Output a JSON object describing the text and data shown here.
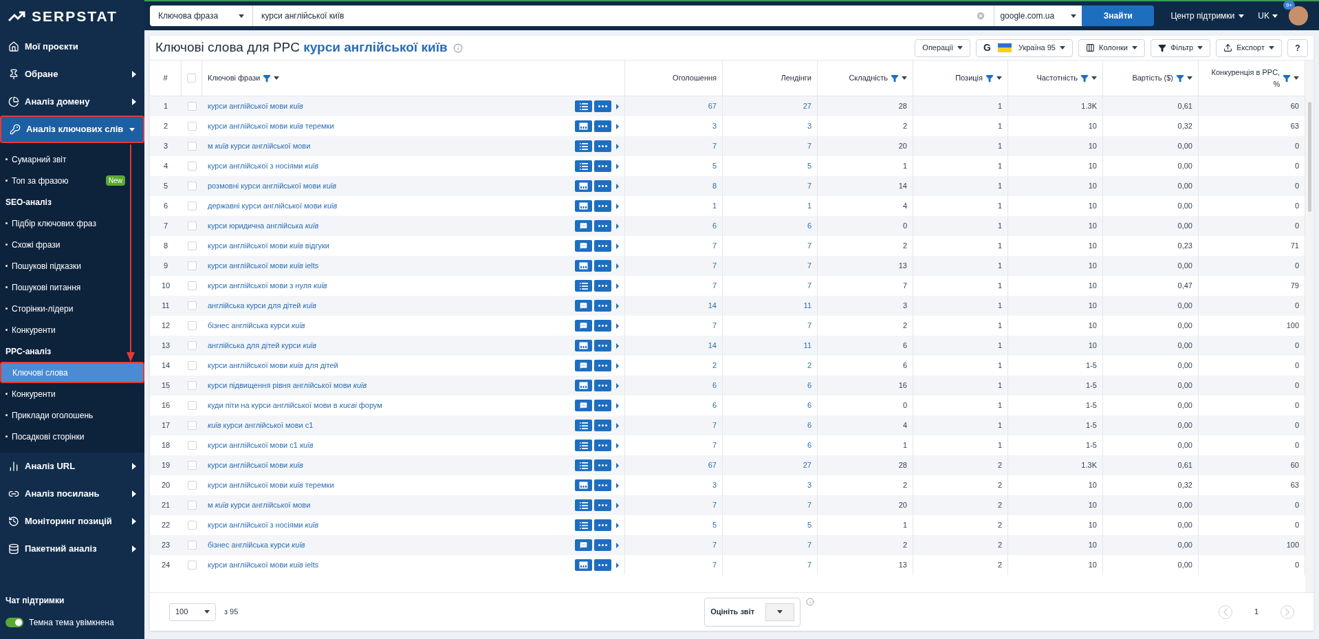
{
  "sidebar": {
    "logo": "SERPSTAT",
    "items": [
      {
        "kind": "main",
        "label": "Мої проєкти",
        "expandable": false,
        "active": false,
        "annotated": false
      },
      {
        "kind": "main",
        "label": "Обране",
        "expandable": true,
        "expanded": false,
        "active": false,
        "annotated": false
      },
      {
        "kind": "main",
        "label": "Аналіз домену",
        "expandable": true,
        "expanded": false,
        "active": false,
        "annotated": false
      },
      {
        "kind": "main",
        "label": "Аналіз ключових слів",
        "expandable": true,
        "expanded": true,
        "active": true,
        "annotated": true
      },
      {
        "kind": "sub",
        "label": "Сумарний звіт",
        "selected": false,
        "annotated": false
      },
      {
        "kind": "sub",
        "label": "Топ за фразою",
        "badge": "New",
        "selected": false,
        "annotated": false
      },
      {
        "kind": "heading",
        "label": "SEO-аналіз"
      },
      {
        "kind": "sub",
        "label": "Підбір ключових фраз",
        "selected": false,
        "annotated": false
      },
      {
        "kind": "sub",
        "label": "Схожі фрази",
        "selected": false,
        "annotated": false
      },
      {
        "kind": "sub",
        "label": "Пошукові підказки",
        "selected": false,
        "annotated": false
      },
      {
        "kind": "sub",
        "label": "Пошукові питання",
        "selected": false,
        "annotated": false
      },
      {
        "kind": "sub",
        "label": "Сторінки-лідери",
        "selected": false,
        "annotated": false
      },
      {
        "kind": "sub",
        "label": "Конкуренти",
        "selected": false,
        "annotated": false
      },
      {
        "kind": "heading",
        "label": "PPC-аналіз"
      },
      {
        "kind": "sub",
        "label": "Ключові слова",
        "selected": true,
        "annotated": true
      },
      {
        "kind": "sub",
        "label": "Конкуренти",
        "selected": false,
        "annotated": false
      },
      {
        "kind": "sub",
        "label": "Приклади оголошень",
        "selected": false,
        "annotated": false
      },
      {
        "kind": "sub",
        "label": "Посадкові сторінки",
        "selected": false,
        "annotated": false
      },
      {
        "kind": "main",
        "label": "Аналіз URL",
        "expandable": true,
        "expanded": false,
        "active": false,
        "annotated": false
      },
      {
        "kind": "main",
        "label": "Аналіз посилань",
        "expandable": true,
        "expanded": false,
        "active": false,
        "annotated": false
      },
      {
        "kind": "main",
        "label": "Моніторинг позицій",
        "expandable": true,
        "expanded": false,
        "active": false,
        "annotated": false
      },
      {
        "kind": "main",
        "label": "Пакетний аналіз",
        "expandable": true,
        "expanded": false,
        "active": false,
        "annotated": false
      }
    ],
    "chat": "Чат підтримки",
    "theme_toggle": {
      "label": "Темна тема увімкнена",
      "on": true
    }
  },
  "topbar": {
    "search_type": "Ключова фраза",
    "query": "курси англійської київ",
    "engine": "google.com.ua",
    "search_button": "Знайти",
    "support": "Центр підтримки",
    "language": "UK",
    "notifications": "9+"
  },
  "header": {
    "title": "Ключові слова для PPC",
    "query": "курси англійської київ",
    "buttons": [
      {
        "kind": "plain",
        "label": "Операції"
      },
      {
        "kind": "region",
        "letter": "G",
        "label": "Україна 95"
      },
      {
        "kind": "columns",
        "label": "Колонки"
      },
      {
        "kind": "filter",
        "label": "Фільтр"
      },
      {
        "kind": "export",
        "label": "Експорт"
      }
    ],
    "help": "?"
  },
  "table": {
    "select_all": {
      "checked": false
    },
    "columns": [
      {
        "label": "#",
        "filter": false,
        "sort": false
      },
      {
        "label": "Ключові фрази",
        "filter": true,
        "sort": true
      },
      {
        "label": "Оголошення",
        "filter": false,
        "sort": false
      },
      {
        "label": "Лендінги",
        "filter": false,
        "sort": false
      },
      {
        "label": "Складність",
        "filter": true,
        "sort": true
      },
      {
        "label": "Позиція",
        "filter": true,
        "sort": true
      },
      {
        "label": "Частотність",
        "filter": true,
        "sort": true
      },
      {
        "label": "Вартість ($)",
        "filter": true,
        "sort": true
      },
      {
        "label": "Конкуренція в PPC, %",
        "filter": true,
        "sort": true
      }
    ],
    "rows": [
      {
        "checked": false,
        "kind": "list",
        "cells": [
          "1",
          "курси англійської мови *київ*",
          "67",
          "27",
          "28",
          "1",
          "1.3K",
          "0,61",
          "60"
        ]
      },
      {
        "checked": false,
        "kind": "ad",
        "cells": [
          "2",
          "курси англійської мови *київ* теремки",
          "3",
          "3",
          "2",
          "1",
          "10",
          "0,32",
          "63"
        ]
      },
      {
        "checked": false,
        "kind": "list",
        "cells": [
          "3",
          "м *київ* курси англійської мови",
          "7",
          "7",
          "20",
          "1",
          "10",
          "0,00",
          "0"
        ]
      },
      {
        "checked": false,
        "kind": "list",
        "cells": [
          "4",
          "курси англійської з носіями *київ*",
          "5",
          "5",
          "1",
          "1",
          "10",
          "0,00",
          "0"
        ]
      },
      {
        "checked": false,
        "kind": "ad",
        "cells": [
          "5",
          "розмовні курси англійської мови *київ*",
          "8",
          "7",
          "14",
          "1",
          "10",
          "0,00",
          "0"
        ]
      },
      {
        "checked": false,
        "kind": "ad",
        "cells": [
          "6",
          "державні курси англійської мови *київ*",
          "1",
          "1",
          "4",
          "1",
          "10",
          "0,00",
          "0"
        ]
      },
      {
        "checked": false,
        "kind": "comment",
        "cells": [
          "7",
          "курси юридична англійська *київ*",
          "6",
          "6",
          "0",
          "1",
          "10",
          "0,00",
          "0"
        ]
      },
      {
        "checked": false,
        "kind": "comment",
        "cells": [
          "8",
          "курси англійської мови *київ* відгуки",
          "7",
          "7",
          "2",
          "1",
          "10",
          "0,23",
          "71"
        ]
      },
      {
        "checked": false,
        "kind": "ad",
        "cells": [
          "9",
          "курси англійської мови *київ* ielts",
          "7",
          "7",
          "13",
          "1",
          "10",
          "0,00",
          "0"
        ]
      },
      {
        "checked": false,
        "kind": "list",
        "cells": [
          "10",
          "курси англійської мови з нуля *київ*",
          "7",
          "7",
          "7",
          "1",
          "10",
          "0,47",
          "79"
        ]
      },
      {
        "checked": false,
        "kind": "comment",
        "cells": [
          "11",
          "англійська курси для дітей *київ*",
          "14",
          "11",
          "3",
          "1",
          "10",
          "0,00",
          "0"
        ]
      },
      {
        "checked": false,
        "kind": "comment",
        "cells": [
          "12",
          "бізнес англійська курси *київ*",
          "7",
          "7",
          "2",
          "1",
          "10",
          "0,00",
          "100"
        ]
      },
      {
        "checked": false,
        "kind": "ad",
        "cells": [
          "13",
          "англійська для дітей курси *київ*",
          "14",
          "11",
          "6",
          "1",
          "10",
          "0,00",
          "0"
        ]
      },
      {
        "checked": false,
        "kind": "comment",
        "cells": [
          "14",
          "курси англійської мови *київ* для дітей",
          "2",
          "2",
          "6",
          "1",
          "1-5",
          "0,00",
          "0"
        ]
      },
      {
        "checked": false,
        "kind": "ad",
        "cells": [
          "15",
          "курси підвищення рівня англійської мови *київ*",
          "6",
          "6",
          "16",
          "1",
          "1-5",
          "0,00",
          "0"
        ]
      },
      {
        "checked": false,
        "kind": "comment",
        "cells": [
          "16",
          "куди піти на курси англійської мови в *києві* форум",
          "6",
          "6",
          "0",
          "1",
          "1-5",
          "0,00",
          "0"
        ]
      },
      {
        "checked": false,
        "kind": "list",
        "cells": [
          "17",
          "*київ* курси англійської мови с1",
          "7",
          "6",
          "4",
          "1",
          "1-5",
          "0,00",
          "0"
        ]
      },
      {
        "checked": false,
        "kind": "list",
        "cells": [
          "18",
          "курси англійської мови с1 *київ*",
          "7",
          "6",
          "1",
          "1",
          "1-5",
          "0,00",
          "0"
        ]
      },
      {
        "checked": false,
        "kind": "list",
        "cells": [
          "19",
          "курси англійської мови *київ*",
          "67",
          "27",
          "28",
          "2",
          "1.3K",
          "0,61",
          "60"
        ]
      },
      {
        "checked": false,
        "kind": "ad",
        "cells": [
          "20",
          "курси англійської мови *київ* теремки",
          "3",
          "3",
          "2",
          "2",
          "10",
          "0,32",
          "63"
        ]
      },
      {
        "checked": false,
        "kind": "list",
        "cells": [
          "21",
          "м *київ* курси англійської мови",
          "7",
          "7",
          "20",
          "2",
          "10",
          "0,00",
          "0"
        ]
      },
      {
        "checked": false,
        "kind": "list",
        "cells": [
          "22",
          "курси англійської з носіями *київ*",
          "5",
          "5",
          "1",
          "2",
          "10",
          "0,00",
          "0"
        ]
      },
      {
        "checked": false,
        "kind": "comment",
        "cells": [
          "23",
          "бізнес англійська курси *київ*",
          "7",
          "7",
          "2",
          "2",
          "10",
          "0,00",
          "100"
        ]
      },
      {
        "checked": false,
        "kind": "ad",
        "cells": [
          "24",
          "курси англійської мови *київ* ielts",
          "7",
          "7",
          "13",
          "2",
          "10",
          "0,00",
          "0"
        ]
      }
    ]
  },
  "footer": {
    "page_size": "100",
    "total": "з 95",
    "rate_label": "Оцініть звіт",
    "page": "1"
  }
}
